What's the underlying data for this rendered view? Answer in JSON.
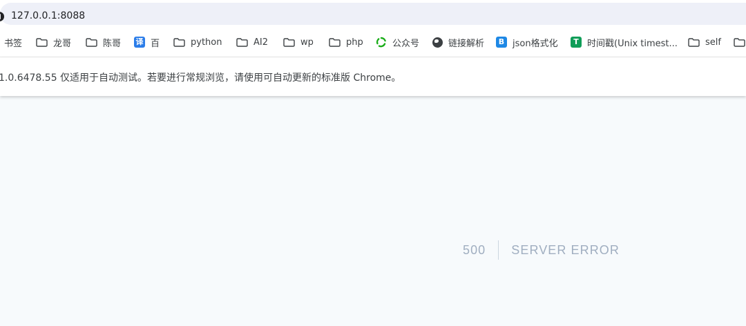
{
  "browser": {
    "url": "127.0.0.1:8088",
    "bookmarks": [
      {
        "label": "书签",
        "icon": "none"
      },
      {
        "label": "龙哥",
        "icon": "folder-icon"
      },
      {
        "label": "陈哥",
        "icon": "folder-icon"
      },
      {
        "label": "百",
        "icon": "translate-icon",
        "glyph": "译",
        "color": "#2b7de9"
      },
      {
        "label": "python",
        "icon": "folder-icon"
      },
      {
        "label": "AI2",
        "icon": "folder-icon"
      },
      {
        "label": "wp",
        "icon": "folder-icon"
      },
      {
        "label": "php",
        "icon": "folder-icon"
      },
      {
        "label": "公众号",
        "icon": "recycle-icon",
        "color": "#1aad19"
      },
      {
        "label": "链接解析",
        "icon": "globe-icon"
      },
      {
        "label": "json格式化",
        "icon": "json-icon",
        "glyph": "B",
        "color": "#1e88e5"
      },
      {
        "label": "时间戳(Unix timest...",
        "icon": "timestamp-icon",
        "glyph": "T",
        "color": "#0f9d58"
      },
      {
        "label": "self",
        "icon": "folder-icon"
      }
    ],
    "infobar_text": "1.0.6478.55 仅适用于自动测试。若要进行常规浏览，请使用可自动更新的标准版 Chrome。"
  },
  "page": {
    "error_code": "500",
    "error_message": "Server Error"
  }
}
